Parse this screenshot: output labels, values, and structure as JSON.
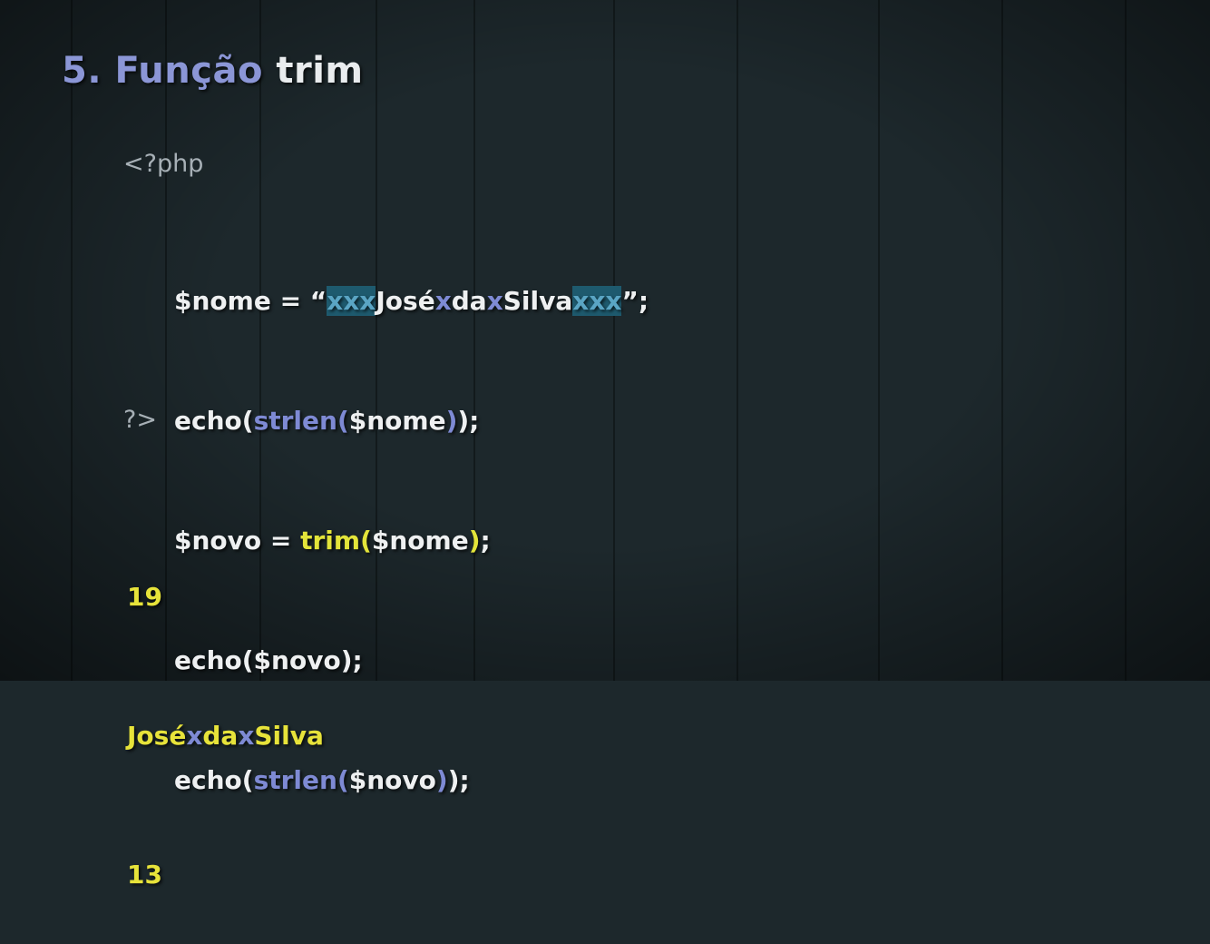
{
  "title": {
    "number": "5.",
    "word1": "Função",
    "word2": "trim"
  },
  "php_open": "<?php",
  "php_close": "?>",
  "code": {
    "line1": {
      "prefix": "$nome = “",
      "pad1": "xxx",
      "w1": "José",
      "x1": "x",
      "w2": "da",
      "x2": "x",
      "w3": "Silva",
      "pad2": "xxx",
      "suffix": "”;"
    },
    "line2": {
      "a": "echo(",
      "fn": "strlen",
      "po": "(",
      "arg": "$nome",
      "pc": ")",
      "end": ");"
    },
    "line3": {
      "a": "$novo = ",
      "fn": "trim",
      "po": "(",
      "arg": "$nome",
      "pc": ")",
      "end": ";"
    },
    "line4": "echo($novo);",
    "line5": {
      "a": "echo(",
      "fn": "strlen",
      "po": "(",
      "arg": "$novo",
      "pc": ")",
      "end": ");"
    }
  },
  "output": {
    "line1": "19",
    "line2": {
      "w1": "José",
      "x1": "x",
      "w2": "da",
      "x2": "x",
      "w3": "Silva"
    },
    "line3": "13"
  },
  "colors": {
    "keyword_blue": "#7e8ad4",
    "accent_yellow": "#e3e43a",
    "highlight": "#1e5a6e"
  }
}
